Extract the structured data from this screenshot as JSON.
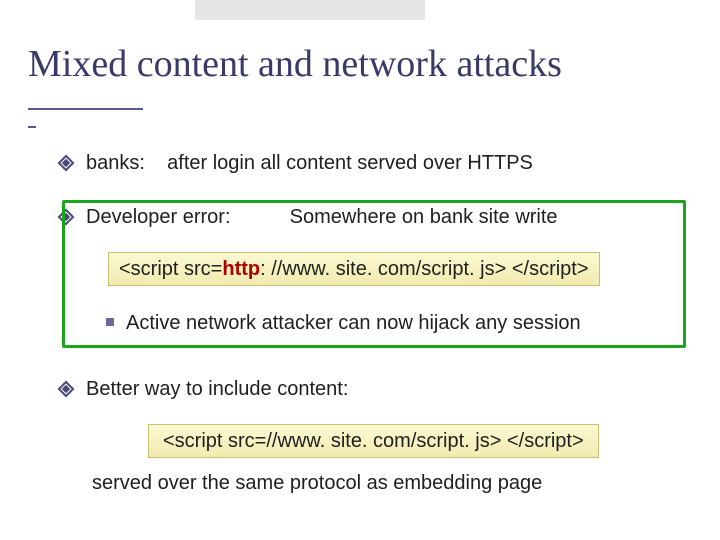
{
  "title": "Mixed content and network attacks",
  "bullets": {
    "b1": "banks:    after login all content served over HTTPS",
    "b2a": "Developer error:",
    "b2b": "Somewhere on bank site write",
    "code1_pre": "<script src=",
    "code1_hl": "http",
    "code1_post": ": //www. site. com/script. js> </script>",
    "sub1": "Active network attacker can now hijack any session",
    "b3": "Better way to include content:",
    "code2": "<script src=//www. site. com/script. js> </script>",
    "tail": "served over the same protocol as embedding page"
  }
}
